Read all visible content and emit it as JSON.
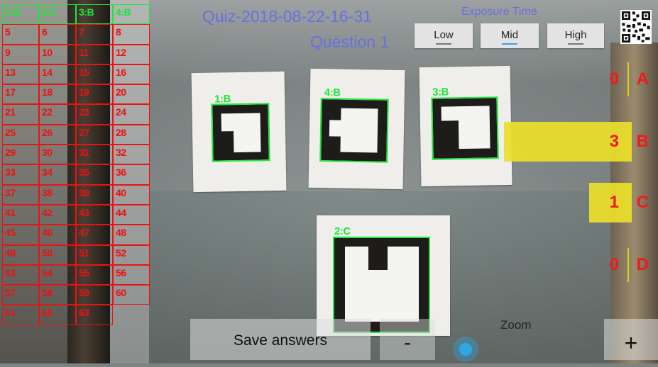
{
  "header": {
    "quiz_title": "Quiz-2018-08-22-16-31",
    "question_label": "Question 1"
  },
  "exposure": {
    "label": "Exposure Time",
    "options": [
      {
        "label": "Low",
        "active": false
      },
      {
        "label": "Mid",
        "active": true
      },
      {
        "label": "High",
        "active": false
      }
    ],
    "selected": "Mid"
  },
  "grid": {
    "cells": [
      {
        "text": "1:B",
        "detected": true
      },
      {
        "text": "2:C",
        "detected": true
      },
      {
        "text": "3:B",
        "detected": true
      },
      {
        "text": "4:B",
        "detected": true
      },
      {
        "text": "5"
      },
      {
        "text": "6"
      },
      {
        "text": "7"
      },
      {
        "text": "8"
      },
      {
        "text": "9"
      },
      {
        "text": "10"
      },
      {
        "text": "11"
      },
      {
        "text": "12"
      },
      {
        "text": "13"
      },
      {
        "text": "14"
      },
      {
        "text": "15"
      },
      {
        "text": "16"
      },
      {
        "text": "17"
      },
      {
        "text": "18"
      },
      {
        "text": "19"
      },
      {
        "text": "20"
      },
      {
        "text": "21"
      },
      {
        "text": "22"
      },
      {
        "text": "23"
      },
      {
        "text": "24"
      },
      {
        "text": "25"
      },
      {
        "text": "26"
      },
      {
        "text": "27"
      },
      {
        "text": "28"
      },
      {
        "text": "29"
      },
      {
        "text": "30"
      },
      {
        "text": "31"
      },
      {
        "text": "32"
      },
      {
        "text": "33"
      },
      {
        "text": "34"
      },
      {
        "text": "35"
      },
      {
        "text": "36"
      },
      {
        "text": "37"
      },
      {
        "text": "38"
      },
      {
        "text": "39"
      },
      {
        "text": "40"
      },
      {
        "text": "41"
      },
      {
        "text": "42"
      },
      {
        "text": "43"
      },
      {
        "text": "44"
      },
      {
        "text": "45"
      },
      {
        "text": "46"
      },
      {
        "text": "47"
      },
      {
        "text": "48"
      },
      {
        "text": "49"
      },
      {
        "text": "50"
      },
      {
        "text": "51"
      },
      {
        "text": "52"
      },
      {
        "text": "53"
      },
      {
        "text": "54"
      },
      {
        "text": "55"
      },
      {
        "text": "56"
      },
      {
        "text": "57"
      },
      {
        "text": "58"
      },
      {
        "text": "59"
      },
      {
        "text": "60"
      },
      {
        "text": "61"
      },
      {
        "text": "62"
      },
      {
        "text": "63"
      }
    ]
  },
  "markers": [
    {
      "label": "1:B"
    },
    {
      "label": "4:B"
    },
    {
      "label": "3:B"
    },
    {
      "label": "2:C"
    }
  ],
  "tallies": [
    {
      "letter": "A",
      "count": "0",
      "fraction": 0.0
    },
    {
      "letter": "B",
      "count": "3",
      "fraction": 0.75
    },
    {
      "letter": "C",
      "count": "1",
      "fraction": 0.25
    },
    {
      "letter": "D",
      "count": "0",
      "fraction": 0.0
    }
  ],
  "controls": {
    "save_label": "Save answers",
    "zoom_label": "Zoom",
    "zoom_minus": "-",
    "zoom_plus": "+",
    "zoom_level": 0.08
  },
  "colors": {
    "title": "#6a6fe0",
    "grid_red": "#ee1111",
    "detected_green": "#1ee63b",
    "tally_yellow": "#ecdf2a",
    "slider_blue": "#2ea7e6"
  },
  "icons": [
    "qr-code-icon"
  ]
}
